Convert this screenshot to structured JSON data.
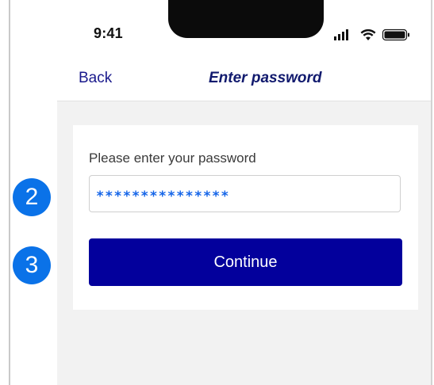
{
  "status_bar": {
    "time": "9:41",
    "icons": [
      "cellular-signal-icon",
      "wifi-icon",
      "battery-icon"
    ]
  },
  "nav": {
    "back_label": "Back",
    "title": "Enter password"
  },
  "form": {
    "field_label": "Please enter your password",
    "password_value": "***************",
    "continue_label": "Continue"
  },
  "annotations": {
    "step_2": "2",
    "step_3": "3"
  },
  "colors": {
    "primary_button": "#03009c",
    "nav_text": "#1a1a8c",
    "masked_text": "#1565e8",
    "badge": "#0a72e8",
    "content_background": "#f2f2f2"
  }
}
